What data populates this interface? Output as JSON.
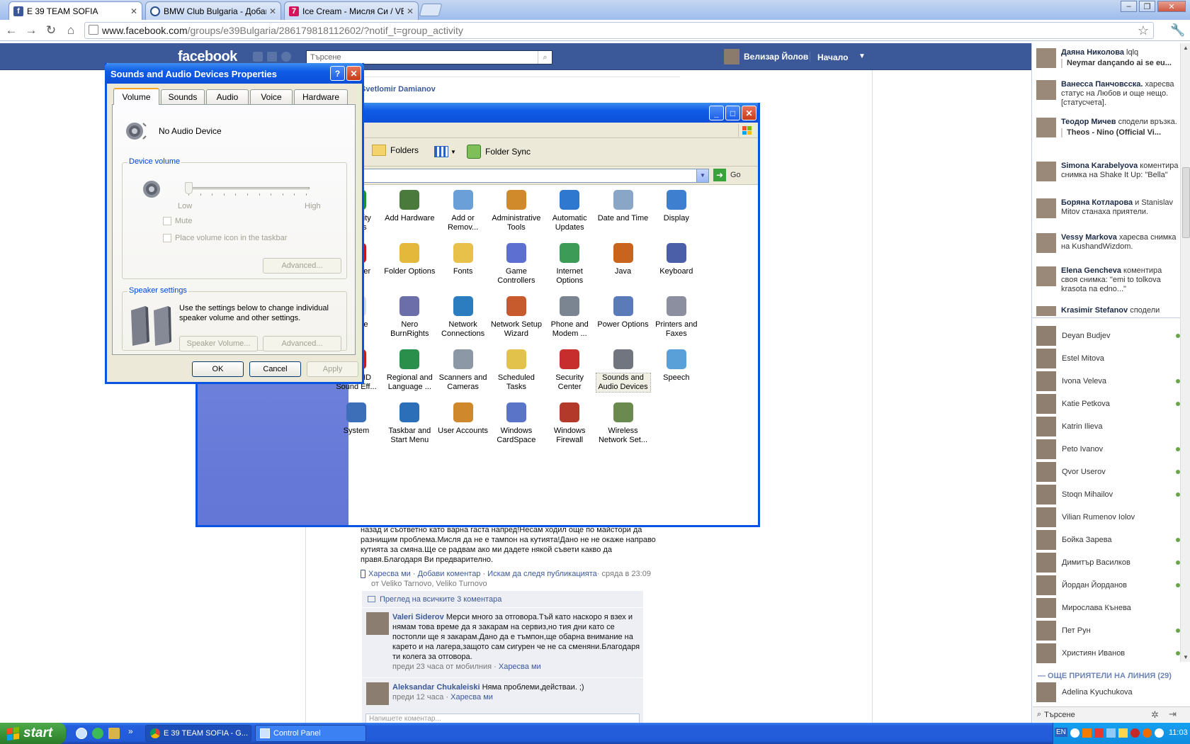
{
  "browser": {
    "tabs": [
      {
        "label": "E 39 TEAM SOFIA",
        "fav": "f",
        "color": "#3b5998"
      },
      {
        "label": "BMW Club Bulgaria - Добави с",
        "fav": "",
        "color": "#2a4f8f"
      },
      {
        "label": "Ice Cream - Мисля Си / VBOX",
        "fav": "7",
        "color": "#d4145a"
      }
    ],
    "url_host": "www.facebook.com",
    "url_path": "/groups/e39Bulgaria/286179818112602/?notif_t=group_activity"
  },
  "fb": {
    "logo": "facebook",
    "search_placeholder": "Търсене",
    "user_name": "Велизар Йолов",
    "home": "Начало",
    "post_author": "Svetlomir Damianov",
    "post_lines": [
      "назад и съответно като варна гаста напред!Несам ходил още по майстори да",
      "разнищим проблема.Мисля да не е тампон на кутията!Дано не не окаже направо",
      "кутията за смяна.Ще се радвам ако ми дадете някой съвети какво да",
      "правя.Благодаря Ви предварително."
    ],
    "post_actions": "Харесва ми · Добави коментар · Искам да следя публикацията",
    "post_time": " · сряда в 23:09",
    "post_location": "от Veliko Tarnovo, Veliko Turnovo",
    "view_all_comments": "Преглед на всичките 3 коментара",
    "comments": [
      {
        "author": "Valeri Siderov",
        "text": "Мерси много за отговора.Тъй като наскоро я взех и нямам това време да я закарам на сервиз,но тия дни като се постопли ще я закарам.Дано да е тъмпон,ще обарна внимание на карето и на лагера,защото сам сигурен че не са сменяни.Благодаря ти колега за отговора.",
        "meta": "преди 23 часа от мобилния · ",
        "like": "Харесва ми"
      },
      {
        "author": "Aleksandar Chukaleiski",
        "text": "Няма проблеми,действаи. ;)",
        "meta": "преди 12 часа · ",
        "like": "Харесва ми"
      }
    ],
    "comment_placeholder": "Напишете коментар..."
  },
  "ticker": [
    {
      "name": "Даяна Николова",
      "text": " lqlq",
      "sub": "Neymar dançando ai se eu..."
    },
    {
      "name": "Ванесса Панчовсска.",
      "text": " харесва статус на Любов и още нещо. [статусчета].",
      "sub": ""
    },
    {
      "name": "Теодор Мичев",
      "text": " сподели връзка.",
      "sub": "Theos - Nino (Official Vi..."
    },
    {
      "name": "Simona Karabelyova",
      "text": " коментира снимка на Shake It Up: \"Bella\"",
      "sub": ""
    },
    {
      "name": "Боряна Котларова",
      "text": " и Stanislav Mitov станаха приятели.",
      "sub": ""
    },
    {
      "name": "Vessy Markova",
      "text": " харесва снимка на KushandWizdom.",
      "sub": ""
    },
    {
      "name": "Elena Gencheva",
      "text": " коментира своя снимка: \"emi to tolkova krasota na edno...\"",
      "sub": ""
    },
    {
      "name": "Krasimir Stefanov",
      "text": " сподели",
      "sub": ""
    }
  ],
  "friends": [
    {
      "name": "Deyan Budjev",
      "online": true
    },
    {
      "name": "Estel Mitova",
      "online": false
    },
    {
      "name": "Ivona Veleva",
      "online": true
    },
    {
      "name": "Katie Petkova",
      "online": true
    },
    {
      "name": "Katrin Ilieva",
      "online": false
    },
    {
      "name": "Peto Ivanov",
      "online": true
    },
    {
      "name": "Qvor Userov",
      "online": true
    },
    {
      "name": "Stoqn Mihailov",
      "online": true
    },
    {
      "name": "Vilian Rumenov Iolov",
      "online": false
    },
    {
      "name": "Бойка Зарева",
      "online": true
    },
    {
      "name": "Димитър Василков",
      "online": true
    },
    {
      "name": "Йордан Йорданов",
      "online": true
    },
    {
      "name": "Мирослава Кънева",
      "online": false
    },
    {
      "name": "Пет Рун",
      "online": true
    },
    {
      "name": "Християн Иванов",
      "online": true
    }
  ],
  "more_friends": "— ОЩЕ ПРИЯТЕЛИ НА ЛИНИЯ (29)",
  "last_friend": "Adelina Kyuchukova",
  "chat_search": "Търсене",
  "control_panel": {
    "toolbar_folders": "Folders",
    "toolbar_foldersync": "Folder Sync",
    "go": "Go",
    "items": [
      {
        "label": "essibility\nptions",
        "icon": "accessibility-icon"
      },
      {
        "label": "Add Hardware",
        "icon": "add-hardware-icon"
      },
      {
        "label": "Add or\nRemov...",
        "icon": "add-remove-programs-icon"
      },
      {
        "label": "Administrative\nTools",
        "icon": "administrative-tools-icon"
      },
      {
        "label": "Automatic\nUpdates",
        "icon": "automatic-updates-icon"
      },
      {
        "label": "Date and Time",
        "icon": "date-time-icon"
      },
      {
        "label": "Display",
        "icon": "display-icon"
      },
      {
        "label": "h Player",
        "icon": "flash-player-icon"
      },
      {
        "label": "Folder Options",
        "icon": "folder-options-icon"
      },
      {
        "label": "Fonts",
        "icon": "fonts-icon"
      },
      {
        "label": "Game\nControllers",
        "icon": "game-controllers-icon"
      },
      {
        "label": "Internet\nOptions",
        "icon": "internet-options-icon"
      },
      {
        "label": "Java",
        "icon": "java-icon"
      },
      {
        "label": "Keyboard",
        "icon": "keyboard-icon"
      },
      {
        "label": "Mouse",
        "icon": "mouse-icon"
      },
      {
        "label": "Nero\nBurnRights",
        "icon": "nero-icon"
      },
      {
        "label": "Network\nConnections",
        "icon": "network-connections-icon"
      },
      {
        "label": "Network Setup\nWizard",
        "icon": "network-setup-icon"
      },
      {
        "label": "Phone and\nModem ...",
        "icon": "phone-modem-icon"
      },
      {
        "label": "Power Options",
        "icon": "power-options-icon"
      },
      {
        "label": "Printers and\nFaxes",
        "icon": "printers-icon"
      },
      {
        "label": "altek HD\nSound Eff...",
        "icon": "realtek-icon"
      },
      {
        "label": "Regional and\nLanguage ...",
        "icon": "regional-icon"
      },
      {
        "label": "Scanners and\nCameras",
        "icon": "scanners-icon"
      },
      {
        "label": "Scheduled\nTasks",
        "icon": "scheduled-tasks-icon"
      },
      {
        "label": "Security\nCenter",
        "icon": "security-center-icon"
      },
      {
        "label": "Sounds and\nAudio Devices",
        "icon": "sounds-icon"
      },
      {
        "label": "Speech",
        "icon": "speech-icon"
      },
      {
        "label": "System",
        "icon": "system-icon"
      },
      {
        "label": "Taskbar and\nStart Menu",
        "icon": "taskbar-icon"
      },
      {
        "label": "User Accounts",
        "icon": "user-accounts-icon"
      },
      {
        "label": "Windows\nCardSpace",
        "icon": "cardspace-icon"
      },
      {
        "label": "Windows\nFirewall",
        "icon": "firewall-icon"
      },
      {
        "label": "Wireless\nNetwork Set...",
        "icon": "wireless-icon"
      }
    ]
  },
  "sound_dialog": {
    "title": "Sounds and Audio Devices Properties",
    "tabs": [
      "Volume",
      "Sounds",
      "Audio",
      "Voice",
      "Hardware"
    ],
    "device": "No Audio Device",
    "device_volume": "Device volume",
    "low": "Low",
    "high": "High",
    "volume_level": 0,
    "mute": "Mute",
    "tray_icon": "Place volume icon in the taskbar",
    "advanced": "Advanced...",
    "speaker_settings": "Speaker settings",
    "speaker_text": "Use the settings below to change individual speaker volume and other settings.",
    "speaker_volume": "Speaker Volume...",
    "ok": "OK",
    "cancel": "Cancel",
    "apply": "Apply"
  },
  "taskbar": {
    "start": "start",
    "tasks": [
      "E 39 TEAM SOFIA - G...",
      "Control Panel"
    ],
    "lang": "EN",
    "clock": "11:03"
  }
}
